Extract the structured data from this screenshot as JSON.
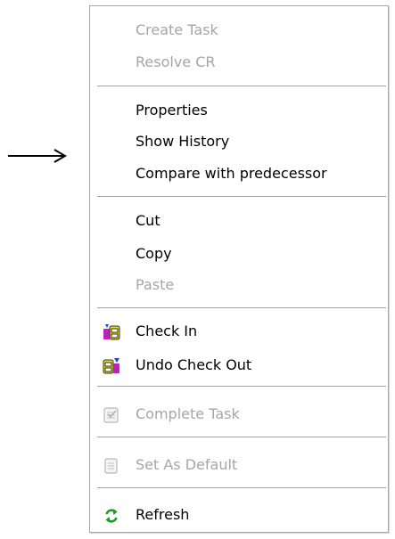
{
  "context_menu": {
    "items": [
      {
        "label": "Create Task",
        "enabled": false
      },
      {
        "label": "Resolve CR",
        "enabled": false
      },
      {
        "label": "Properties",
        "enabled": true
      },
      {
        "label": "Show History",
        "enabled": true
      },
      {
        "label": "Compare with predecessor",
        "enabled": true
      },
      {
        "label": "Cut",
        "enabled": true
      },
      {
        "label": "Copy",
        "enabled": true
      },
      {
        "label": "Paste",
        "enabled": false
      },
      {
        "label": "Check In",
        "enabled": true,
        "icon": "check-in-icon"
      },
      {
        "label": "Undo Check Out",
        "enabled": true,
        "icon": "undo-check-out-icon"
      },
      {
        "label": "Complete Task",
        "enabled": false,
        "icon": "complete-task-icon"
      },
      {
        "label": "Set As Default",
        "enabled": false,
        "icon": "set-default-icon"
      },
      {
        "label": "Refresh",
        "enabled": true,
        "icon": "refresh-icon"
      }
    ]
  },
  "colors": {
    "enabled_text": "#000000",
    "disabled_text": "#a6a6a6",
    "separator": "#a0a0a0",
    "menu_border": "#a7a7a7"
  }
}
